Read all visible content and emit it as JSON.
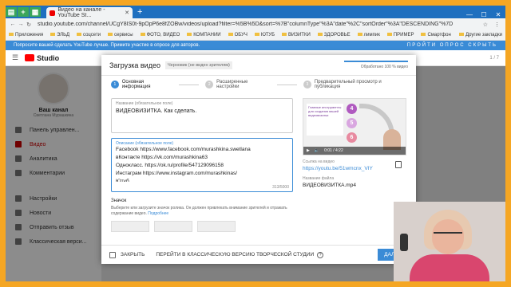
{
  "colors": {
    "frame": "#f5a623",
    "accent": "#3a8bd6",
    "brand": "#ff0000",
    "active_side": "#cc0000"
  },
  "browser": {
    "tab_title": "Видео на канале - YouTube St...",
    "url": "studio.youtube.com/channel/UCgY8IS0t-9pOpP6e8fZOBw/videos/upload?filter=%5B%5D&sort=%7B\"columnType\"%3A\"date\"%2C\"sortOrder\"%3A\"DESCENDING\"%7D",
    "bookmarks": [
      "Приложения",
      "ЭЛЬД",
      "соцсети",
      "сервисы",
      "ФОТО, ВИДЕО",
      "КОМПАНИИ",
      "ОБУЧ",
      "ЮТУБ",
      "ВИЗИТКИ",
      "ЗДОРОВЬЕ",
      "лимпик",
      "ПРИМЕР",
      "Смартфон"
    ],
    "bookmarks_right": "Другие закладки"
  },
  "notice": {
    "text": "Попросите вашей сделать YouTube лучше. Примите участие в опросе для авторов.",
    "right": "ПРОЙТИ ОПРОС   СКРЫТЬ"
  },
  "studio": {
    "name": "Studio",
    "page_counter": "1 / 7"
  },
  "sidebar": {
    "channel_title": "Ваш канал",
    "owner": "Светлана Мурашкина",
    "items": [
      {
        "label": "Панель управлен..."
      },
      {
        "label": "Видео"
      },
      {
        "label": "Аналитика"
      },
      {
        "label": "Комментарии"
      },
      {
        "label": "Настройки"
      },
      {
        "label": "Новости"
      },
      {
        "label": "Отправить отзыв"
      },
      {
        "label": "Классическая верси..."
      }
    ]
  },
  "dialog": {
    "title": "Загрузка видео",
    "draft": "Черновик (не виден зрителям)",
    "progress_text": "Обработано 100 % видео",
    "progress_value": 1.0,
    "steps": [
      {
        "num": "1",
        "label": "Основная информация"
      },
      {
        "num": "2",
        "label": "Расширенные настройки"
      },
      {
        "num": "3",
        "label": "Предварительный просмотр и публикация"
      }
    ],
    "title_label": "Название (обязательное поле)",
    "title_value": "ВИДЕОВИЗИТКА. Как сделать.",
    "desc_label": "Описание (обязательное поле)",
    "desc_lines": [
      "Facebook    https://www.facebook.com/murashkina.swetlana",
      "вКонтакте   https://vk.com/murashkina63",
      "Однокласс.   https://ok.ru/profile/547129096158",
      "Инстаграм   https://www.instagram.com/murashkinas/",
      "Ютуб"
    ],
    "desc_count": "313/5000",
    "icons_heading": "Значок",
    "icons_text": "Выберите или загрузите значок ролика. Он должен привлекать внимание зрителей и отражать содержание видео.",
    "icons_more": "Подробнее",
    "preview": {
      "card_text": "Главные инструменты для создания вашей видеовизитки",
      "circles": [
        "4",
        "5",
        "6"
      ],
      "time": "0:01 / 4:22",
      "link_label": "Ссылка на видео",
      "link": "https://youtu.be/51wmcnx_VIY",
      "file_label": "Название файла",
      "file": "ВИДЕОВИЗИТКА.mp4"
    },
    "footer": {
      "close": "ЗАКРЫТЬ",
      "classic": "ПЕРЕЙТИ В КЛАССИЧЕСКУЮ ВЕРСИЮ ТВОРЧЕСКОЙ СТУДИИ",
      "next": "ДАЛЕЕ"
    }
  }
}
